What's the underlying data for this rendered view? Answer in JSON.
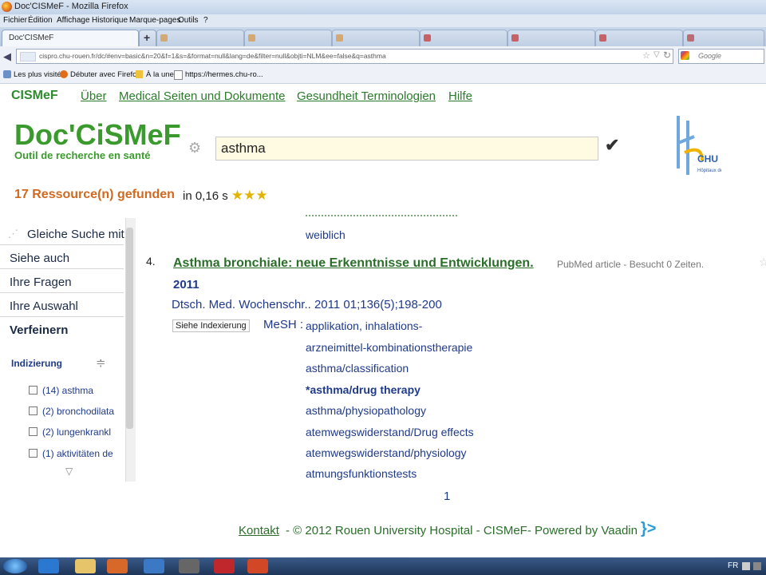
{
  "window": {
    "title": "Doc'CISMeF - Mozilla Firefox"
  },
  "menubar": [
    "Fichier",
    "Édition",
    "Affichage",
    "Historique",
    "Marque-pages",
    "Outils",
    "?"
  ],
  "tabs": [
    {
      "label": "Doc'CISMeF",
      "active": true
    },
    {
      "label": "+"
    }
  ],
  "address": {
    "url": "cispro.chu-rouen.fr/dc/#env=basic&n=20&f=1&s=&format=null&lang=de&filter=null&objti=NLM&ee=false&q=asthma",
    "search_placeholder": "Google"
  },
  "bookmarks": [
    "Les plus visités",
    "Débuter avec Firefox",
    "À la une",
    "https://hermes.chu-ro..."
  ],
  "topnav": {
    "brand": "CISMeF",
    "items": [
      "Über",
      "Medical Seiten und Dokumente",
      "Gesundheit Terminologien",
      "Hilfe"
    ]
  },
  "logo": {
    "name": "Doc'CiSMeF",
    "tagline": "Outil de recherche en santé",
    "partner": "CHU Hôpitaux de Rouen"
  },
  "search": {
    "query": "asthma"
  },
  "results_summary": {
    "count_text": "17 Ressource(n) gefunden",
    "timing": "in 0,16 s",
    "stars": "★★★"
  },
  "sidebar": {
    "items": [
      "Gleiche Suche mit",
      "Siehe auch",
      "Ihre Fragen",
      "Ihre Auswahl",
      "Verfeinern"
    ],
    "indexing_title": "Indizierung",
    "indexing_items": [
      "(14) asthma",
      "(2) bronchodilata",
      "(2) lungenkrankl",
      "(1) aktivitäten de"
    ]
  },
  "result": {
    "prev_tail": "weiblich",
    "number": "4.",
    "title": "Asthma bronchiale: neue Erkenntnisse und Entwicklungen.",
    "meta": "PubMed article - Besucht 0 Zeiten.",
    "year": "2011",
    "citation": "Dtsch. Med. Wochenschr.. 2011 01;136(5);198-200",
    "index_button": "Siehe Indexierung",
    "mesh_label": "MeSH :",
    "mesh_terms": [
      "applikation, inhalations-",
      "arzneimittel-kombinationstherapie",
      "asthma/classification",
      "*asthma/drug therapy",
      "asthma/physiopathology",
      "atemwegswiderstand/Drug effects",
      "atemwegswiderstand/physiology",
      "atmungsfunktionstests"
    ]
  },
  "pagination": {
    "page": "1"
  },
  "footer": {
    "contact": "Kontakt ",
    "text": "- © 2012 Rouen University Hospital - CISMeF- Powered by Vaadin"
  },
  "taskbar": {
    "lang": "FR"
  }
}
